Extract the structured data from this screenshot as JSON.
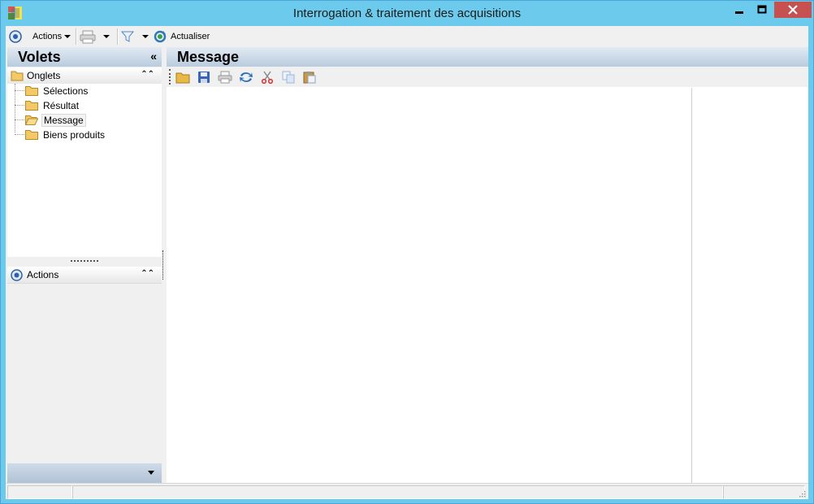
{
  "window": {
    "title": "Interrogation & traitement des acquisitions",
    "minimize": "minimize",
    "maximize": "maximize",
    "close": "close"
  },
  "toolbar": {
    "actions_label": "Actions",
    "refresh_label": "Actualiser",
    "icons": [
      "actions-icon",
      "printer-icon",
      "filter-icon",
      "refresh-icon"
    ]
  },
  "left_pane": {
    "title": "Volets",
    "collapse_symbol": "«",
    "onglets": {
      "title": "Onglets",
      "items": [
        {
          "label": "Sélections",
          "selected": false
        },
        {
          "label": "Résultat",
          "selected": false
        },
        {
          "label": "Message",
          "selected": true
        },
        {
          "label": "Biens produits",
          "selected": false
        }
      ]
    },
    "actions_section": {
      "title": "Actions"
    }
  },
  "right_pane": {
    "title": "Message",
    "toolbar_icons": [
      "open-folder-icon",
      "save-icon",
      "print-icon",
      "sync-icon",
      "cut-icon",
      "copy-icon",
      "paste-icon"
    ]
  },
  "colors": {
    "titlebar": "#6ccbec",
    "close_button": "#c75050",
    "pane_header_gradient": [
      "#e2eaf3",
      "#b9cbdd"
    ]
  }
}
